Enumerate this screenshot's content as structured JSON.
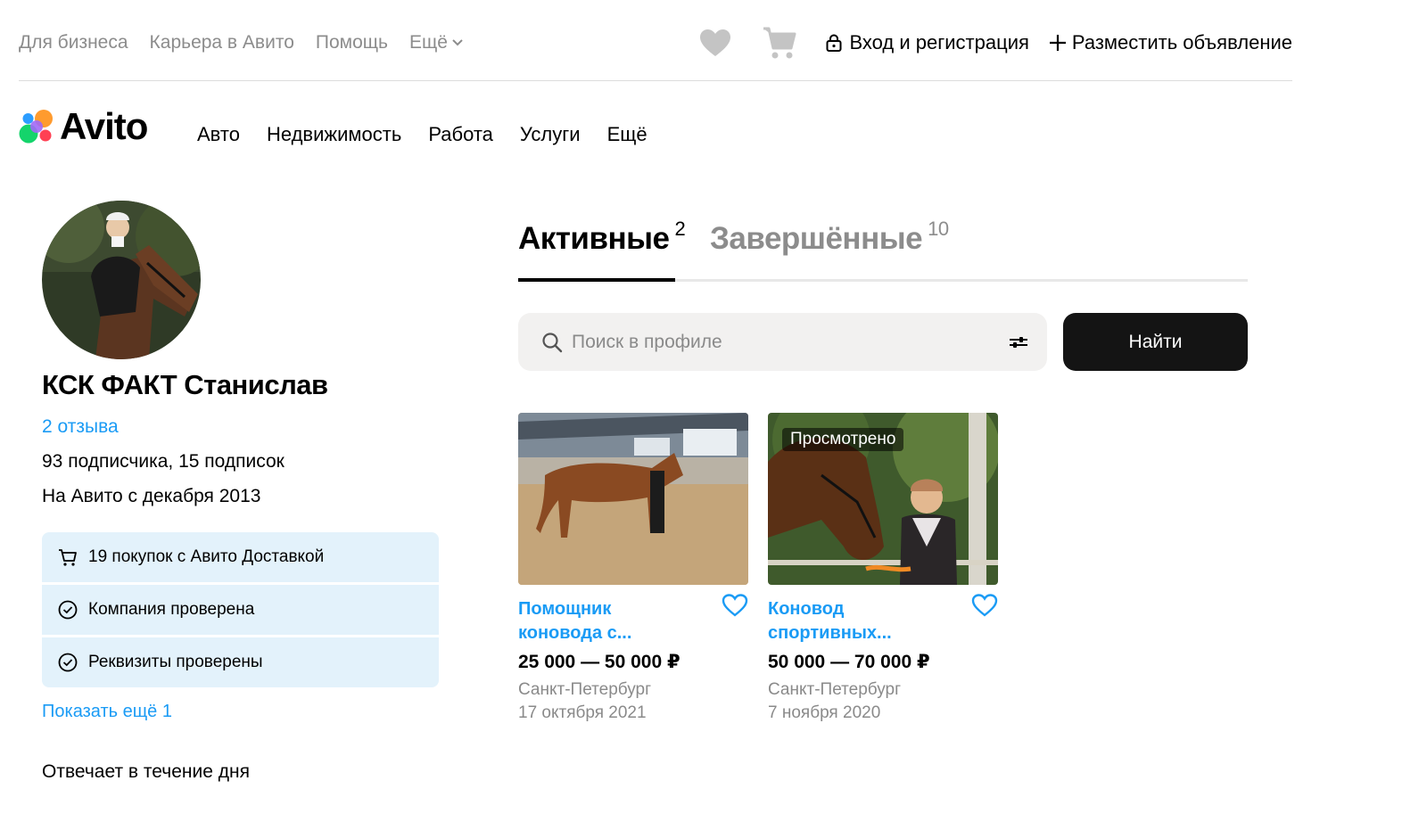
{
  "topbar": {
    "links": [
      "Для бизнеса",
      "Карьера в Авито",
      "Помощь"
    ],
    "more_label": "Ещё",
    "login_label": "Вход и регистрация",
    "post_label": "Разместить объявление"
  },
  "nav": {
    "logo_text": "Avito",
    "items": [
      "Авто",
      "Недвижимость",
      "Работа",
      "Услуги",
      "Ещё"
    ]
  },
  "profile": {
    "name": "КСК ФАКТ Станислав",
    "reviews": "2 отзыва",
    "subscribers": "93 подписчика, 15 подписок",
    "since": "На Авито с декабря 2013",
    "badges": [
      {
        "icon": "cart-icon",
        "label": "19 покупок с Авито Доставкой"
      },
      {
        "icon": "check-circle-icon",
        "label": "Компания проверена"
      },
      {
        "icon": "check-circle-icon",
        "label": "Реквизиты проверены"
      }
    ],
    "show_more": "Показать ещё 1",
    "response_time": "Отвечает в течение дня"
  },
  "tabs": {
    "active": {
      "label": "Активные",
      "count": "2"
    },
    "done": {
      "label": "Завершённые",
      "count": "10"
    }
  },
  "search": {
    "placeholder": "Поиск в профиле",
    "button_label": "Найти"
  },
  "listings": [
    {
      "title_line1": "Помощник",
      "title_line2": "коновода с...",
      "price": "25 000 — 50 000 ₽",
      "city": "Санкт-Петербург",
      "date": "17 октября 2021",
      "viewed": ""
    },
    {
      "title_line1": "Коновод",
      "title_line2": "спортивных...",
      "price": "50 000 — 70 000 ₽",
      "city": "Санкт-Петербург",
      "date": "7 ноября 2020",
      "viewed": "Просмотрено"
    }
  ],
  "colors": {
    "link_blue": "#1a9bf5",
    "badge_bg": "#e3f2fb",
    "button_dark": "#141414",
    "muted": "#8c8c8c"
  }
}
